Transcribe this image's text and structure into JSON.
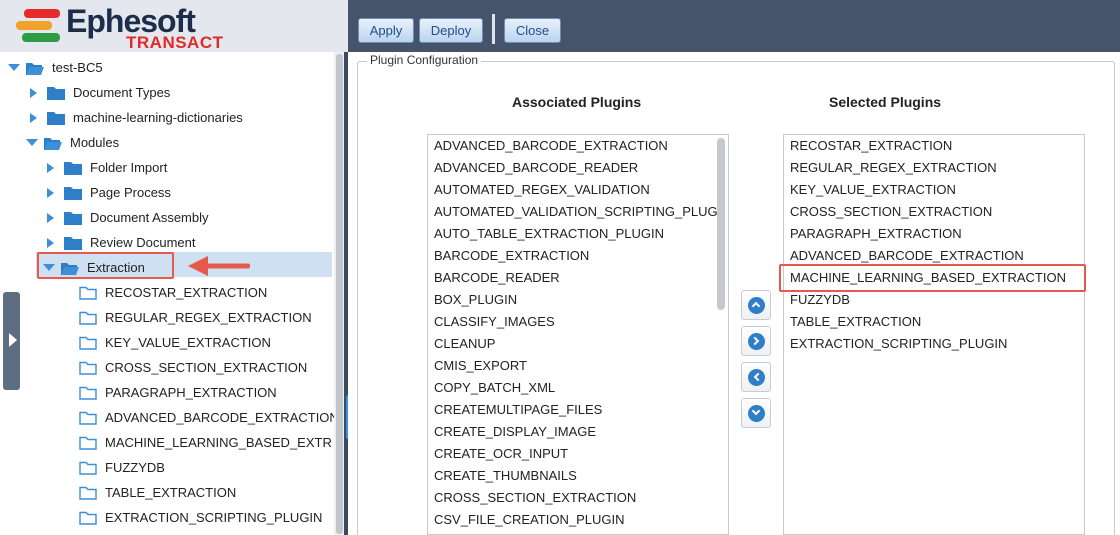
{
  "app": {
    "logo_text": "Ephesoft",
    "logo_sub": "TRANSACT",
    "colors": {
      "header": "#45546a",
      "accent_blue": "#3b8fdc",
      "highlight_red": "#e55a4a",
      "selection": "#cfe0f3"
    }
  },
  "toolbar": {
    "apply_label": "Apply",
    "deploy_label": "Deploy",
    "close_label": "Close"
  },
  "tree": {
    "root": "test-BC5",
    "children": [
      "Document Types",
      "machine-learning-dictionaries",
      "Modules"
    ],
    "modules": [
      "Folder Import",
      "Page Process",
      "Document Assembly",
      "Review Document",
      "Extraction"
    ],
    "extraction_children": [
      "RECOSTAR_EXTRACTION",
      "REGULAR_REGEX_EXTRACTION",
      "KEY_VALUE_EXTRACTION",
      "CROSS_SECTION_EXTRACTION",
      "PARAGRAPH_EXTRACTION",
      "ADVANCED_BARCODE_EXTRACTION",
      "MACHINE_LEARNING_BASED_EXTR",
      "FUZZYDB",
      "TABLE_EXTRACTION",
      "EXTRACTION_SCRIPTING_PLUGIN"
    ]
  },
  "plugin_config": {
    "legend": "Plugin Configuration",
    "associated_title": "Associated Plugins",
    "selected_title": "Selected Plugins",
    "associated": [
      "ADVANCED_BARCODE_EXTRACTION",
      "ADVANCED_BARCODE_READER",
      "AUTOMATED_REGEX_VALIDATION",
      "AUTOMATED_VALIDATION_SCRIPTING_PLUG",
      "AUTO_TABLE_EXTRACTION_PLUGIN",
      "BARCODE_EXTRACTION",
      "BARCODE_READER",
      "BOX_PLUGIN",
      "CLASSIFY_IMAGES",
      "CLEANUP",
      "CMIS_EXPORT",
      "COPY_BATCH_XML",
      "CREATEMULTIPAGE_FILES",
      "CREATE_DISPLAY_IMAGE",
      "CREATE_OCR_INPUT",
      "CREATE_THUMBNAILS",
      "CROSS_SECTION_EXTRACTION",
      "CSV_FILE_CREATION_PLUGIN"
    ],
    "selected": [
      "RECOSTAR_EXTRACTION",
      "REGULAR_REGEX_EXTRACTION",
      "KEY_VALUE_EXTRACTION",
      "CROSS_SECTION_EXTRACTION",
      "PARAGRAPH_EXTRACTION",
      "ADVANCED_BARCODE_EXTRACTION",
      "MACHINE_LEARNING_BASED_EXTRACTION",
      "FUZZYDB",
      "TABLE_EXTRACTION",
      "EXTRACTION_SCRIPTING_PLUGIN"
    ],
    "move_buttons": [
      "move-up-icon",
      "move-right-icon",
      "move-left-icon",
      "move-down-icon"
    ]
  }
}
